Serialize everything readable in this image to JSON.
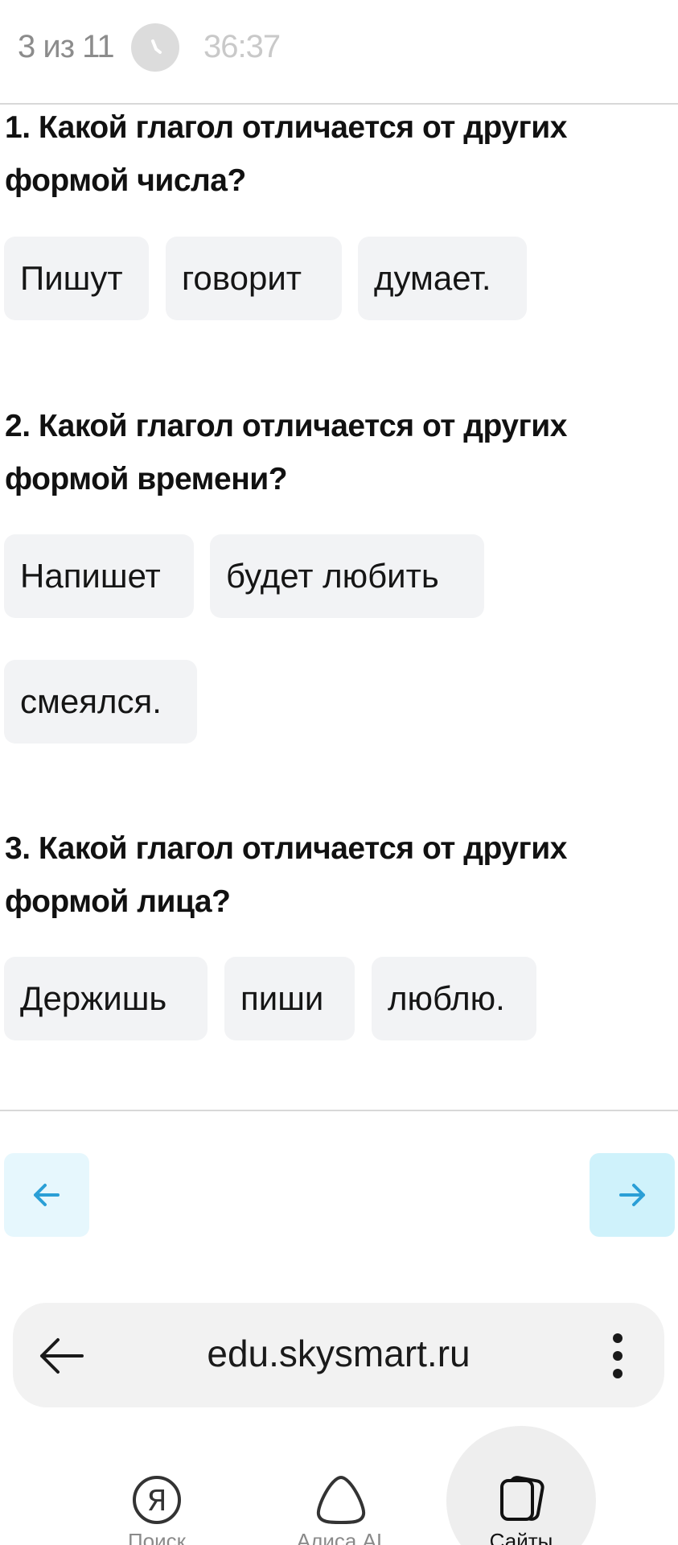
{
  "header": {
    "progress": "3 из 11",
    "timer": "36:37"
  },
  "questions": [
    {
      "line1": "1. Какой глагол отличается от других",
      "line2": "формой числа?",
      "options": [
        "Пишут",
        "говорит",
        "думает."
      ]
    },
    {
      "line1": "2. Какой глагол отличается от других",
      "line2": "формой времени?",
      "options": [
        "Напишет",
        "будет любить",
        "смеялся."
      ]
    },
    {
      "line1": "3. Какой глагол отличается от других",
      "line2": "формой лица?",
      "options": [
        "Держишь",
        "пиши",
        "люблю."
      ]
    }
  ],
  "navigation": {
    "prev_icon": "arrow-left-icon",
    "next_icon": "arrow-right-icon",
    "accent": "#2a9fd6"
  },
  "browser": {
    "url": "edu.skysmart.ru"
  },
  "tabs": {
    "search_label": "Поиск",
    "alice_label": "Алиса AI",
    "sites_label": "Сайты"
  }
}
